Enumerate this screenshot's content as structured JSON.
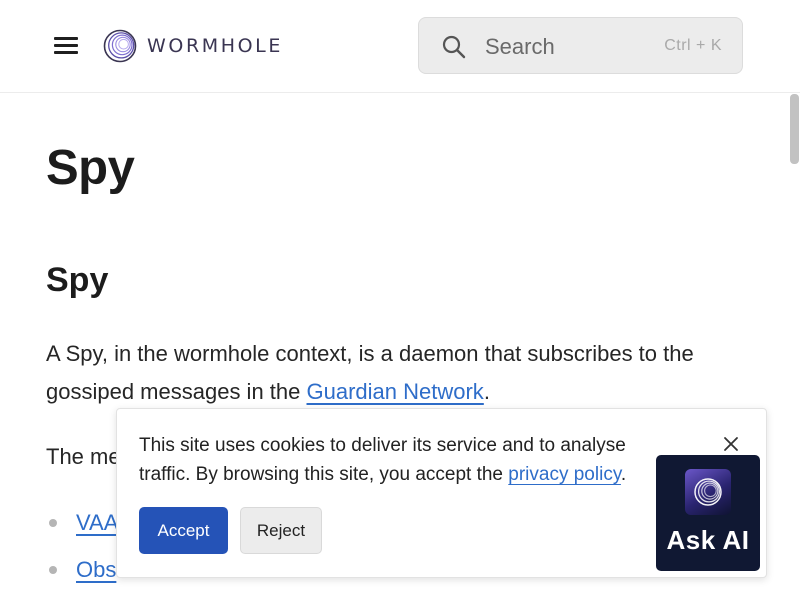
{
  "header": {
    "logo_text": "WORMHOLE",
    "search": {
      "placeholder": "Search",
      "shortcut": "Ctrl + K"
    }
  },
  "main": {
    "title": "Spy",
    "section_heading": "Spy",
    "intro": {
      "before_link": "A Spy, in the wormhole context, is a daemon that subscribes to the gossiped messages in the ",
      "link_text": "Guardian Network",
      "after_link": "."
    },
    "para2_visible": "The me",
    "bullets": [
      {
        "label": "VAA"
      },
      {
        "label": "Obs"
      }
    ]
  },
  "cookie_banner": {
    "text_before_link": "This site uses cookies to deliver its service and to analyse traffic. By browsing this site, you accept the ",
    "link_text": "privacy policy",
    "text_after_link": ".",
    "accept_label": "Accept",
    "reject_label": "Reject"
  },
  "ask_ai": {
    "label": "Ask AI"
  },
  "icons": {
    "menu": "hamburger-menu-icon",
    "logo": "wormhole-logo-icon",
    "search": "search-icon",
    "close": "close-icon",
    "ask_ai_logo": "wormhole-logo-icon"
  },
  "colors": {
    "link": "#2e6dc9",
    "accept_button": "#2553b7",
    "ask_ai_background": "#101833",
    "logo_text": "#3a3552"
  }
}
